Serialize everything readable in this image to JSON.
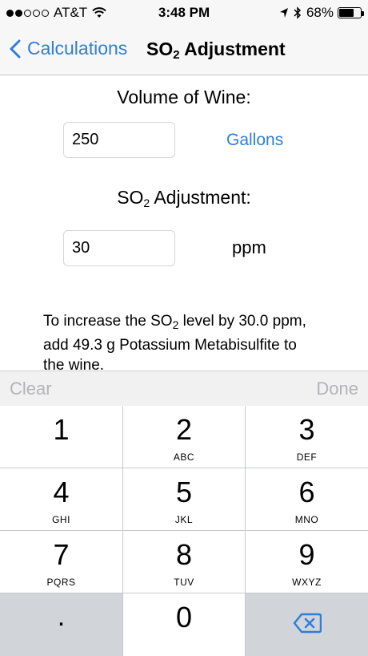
{
  "status_bar": {
    "carrier": "AT&T",
    "time": "3:48 PM",
    "battery": "68%",
    "battery_level": 0.68,
    "signal_bars": 2,
    "signal_total": 5
  },
  "nav": {
    "back_label": "Calculations",
    "title_prefix": "SO",
    "title_sub": "2",
    "title_suffix": " Adjustment"
  },
  "form": {
    "volume_label": "Volume of Wine:",
    "volume_value": "250",
    "volume_unit": "Gallons",
    "so2_label_prefix": "SO",
    "so2_label_sub": "2",
    "so2_label_suffix": " Adjustment:",
    "so2_value": "30",
    "so2_unit": "ppm"
  },
  "result": {
    "part1": "To increase the SO",
    "sub": "2",
    "part2": " level by 30.0 ppm, add 49.3 g Potassium Metabisulfite to the wine."
  },
  "toolbar": {
    "clear_label": "Clear",
    "done_label": "Done"
  },
  "keypad": {
    "keys": [
      {
        "digit": "1",
        "letters": ""
      },
      {
        "digit": "2",
        "letters": "ABC"
      },
      {
        "digit": "3",
        "letters": "DEF"
      },
      {
        "digit": "4",
        "letters": "GHI"
      },
      {
        "digit": "5",
        "letters": "JKL"
      },
      {
        "digit": "6",
        "letters": "MNO"
      },
      {
        "digit": "7",
        "letters": "PQRS"
      },
      {
        "digit": "8",
        "letters": "TUV"
      },
      {
        "digit": "9",
        "letters": "WXYZ"
      },
      {
        "digit": ".",
        "letters": ""
      },
      {
        "digit": "0",
        "letters": ""
      },
      {
        "digit": "",
        "letters": "",
        "icon": "backspace-icon"
      }
    ]
  },
  "colors": {
    "accent": "#2f7ed8",
    "disabled": "#b4b4b8"
  }
}
